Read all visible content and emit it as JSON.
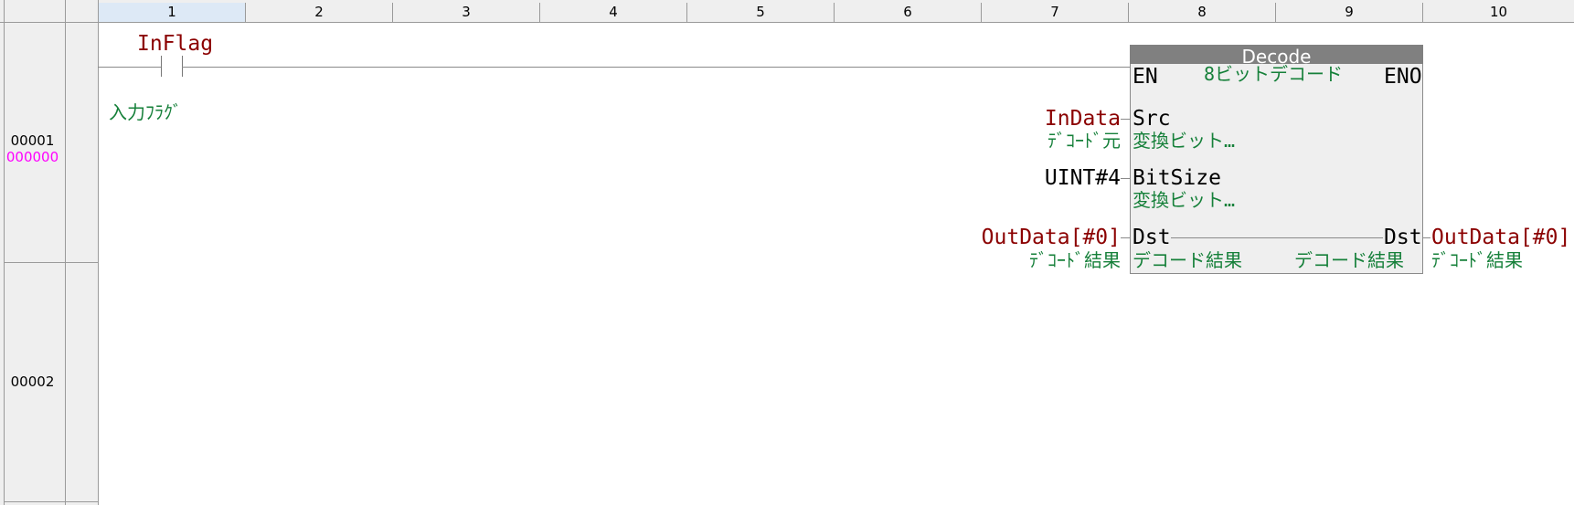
{
  "ruler": {
    "columns": [
      "1",
      "2",
      "3",
      "4",
      "5",
      "6",
      "7",
      "8",
      "9",
      "10"
    ],
    "selected_column": "1"
  },
  "rungs": [
    {
      "number": "00001",
      "step": "000000"
    },
    {
      "number": "00002"
    }
  ],
  "contact": {
    "variable": "InFlag",
    "comment": "入力ﾌﾗｸﾞ"
  },
  "function_block": {
    "name": "Decode",
    "instance_comment": "8ビットデコード",
    "en_label": "EN",
    "eno_label": "ENO",
    "inputs": [
      {
        "param": "Src",
        "param_comment": "変換ビット…",
        "variable": "InData",
        "variable_comment": "ﾃﾞｺｰﾄﾞ元"
      },
      {
        "param": "BitSize",
        "param_comment": "変換ビット…",
        "variable": "UINT#4",
        "variable_comment": ""
      }
    ],
    "inout": {
      "param_in": "Dst",
      "param_in_comment": "デコード結果",
      "param_out": "Dst",
      "param_out_comment": "デコード結果",
      "variable_in": "OutData[#0]",
      "variable_in_comment": "ﾃﾞｺｰﾄﾞ結果",
      "variable_out": "OutData[#0]",
      "variable_out_comment": "ﾃﾞｺｰﾄﾞ結果"
    }
  },
  "colors": {
    "variable": "#8b0000",
    "comment": "#16803a",
    "step": "#ff00ff",
    "fb_title_bg": "#808080",
    "fb_body_bg": "#efefef"
  }
}
